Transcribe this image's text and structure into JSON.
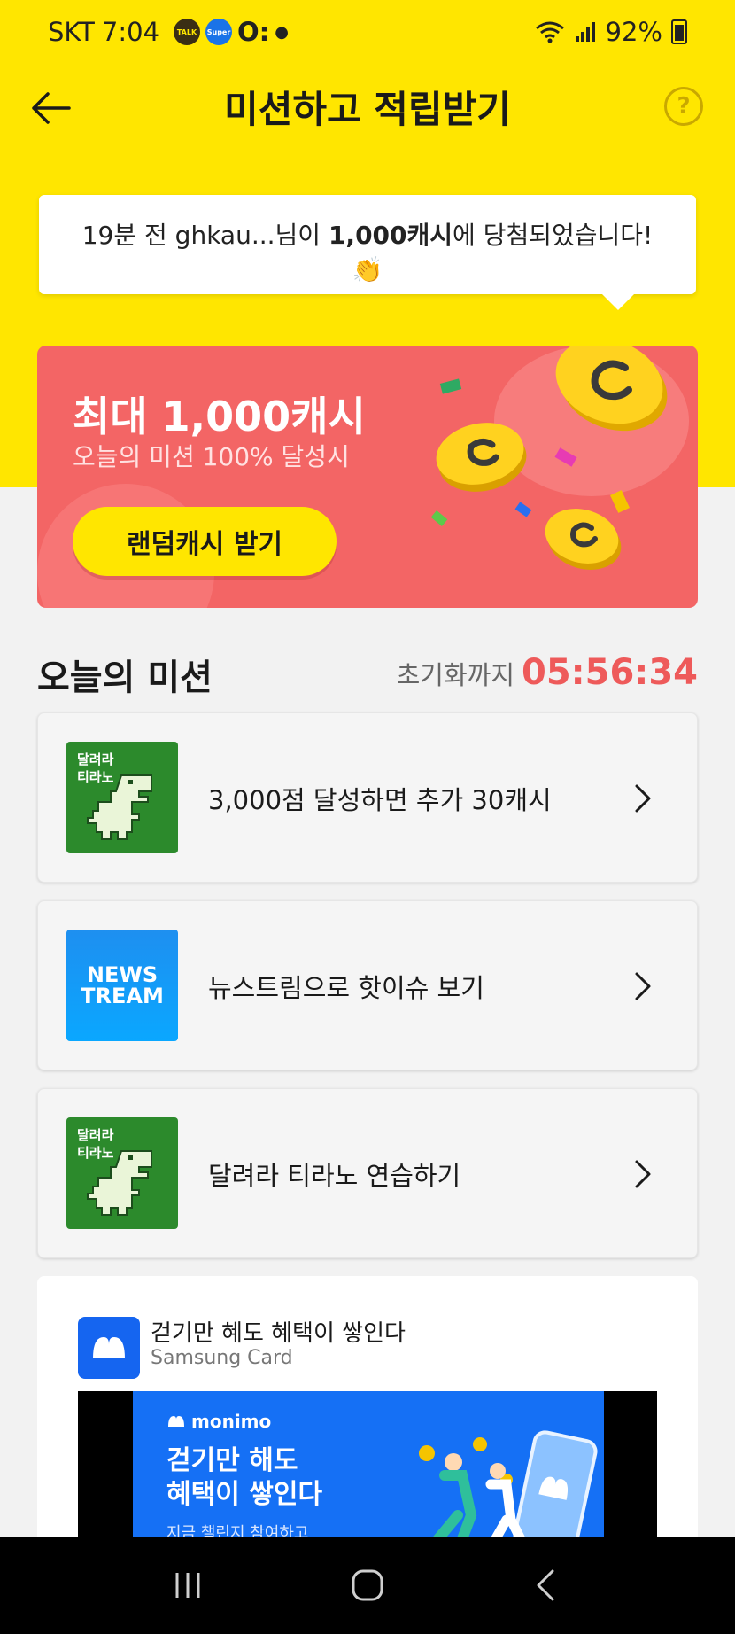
{
  "status_bar": {
    "carrier": "SKT",
    "time": "7:04",
    "notif_talk": "TALK",
    "notif_super": "Super",
    "notif_oi": "O:",
    "battery": "92%"
  },
  "header": {
    "title": "미션하고 적립받기",
    "help_label": "?"
  },
  "winner_notice": {
    "prefix": "19분 전 ghkau...님이 ",
    "amount": "1,000캐시",
    "suffix": "에 당첨되었습니다!",
    "emoji": "👏"
  },
  "banner": {
    "title": "최대 1,000캐시",
    "subtitle": "오늘의 미션 100% 달성시",
    "button_label": "랜덤캐시 받기"
  },
  "missions_section": {
    "title": "오늘의 미션",
    "timer_label": "초기화까지",
    "timer_value": "05:56:34"
  },
  "missions": [
    {
      "text": "3,000점 달성하면 추가 30캐시",
      "thumb_line1": "달려라",
      "thumb_line2": "티라노",
      "icon": "dino-icon"
    },
    {
      "text": "뉴스트림으로 핫이슈 보기",
      "thumb_line1": "NEWS",
      "thumb_line2": "TREAM",
      "icon": "newstream-icon"
    },
    {
      "text": "달려라 티라노 연습하기",
      "thumb_line1": "달려라",
      "thumb_line2": "티라노",
      "icon": "dino-icon"
    }
  ],
  "ad": {
    "title": "걷기만 혜도 혜택이 쌓인다",
    "brand": "Samsung Card",
    "image_brand": "monimo",
    "image_headline_1": "걷기만 해도",
    "image_headline_2": "혜택이 쌓인다",
    "image_sub": "지금 챌린지 참여하고"
  },
  "colors": {
    "header_yellow": "#ffe600",
    "banner_red": "#f36565",
    "timer_red": "#ee5a5a",
    "ad_blue": "#1570f5"
  }
}
